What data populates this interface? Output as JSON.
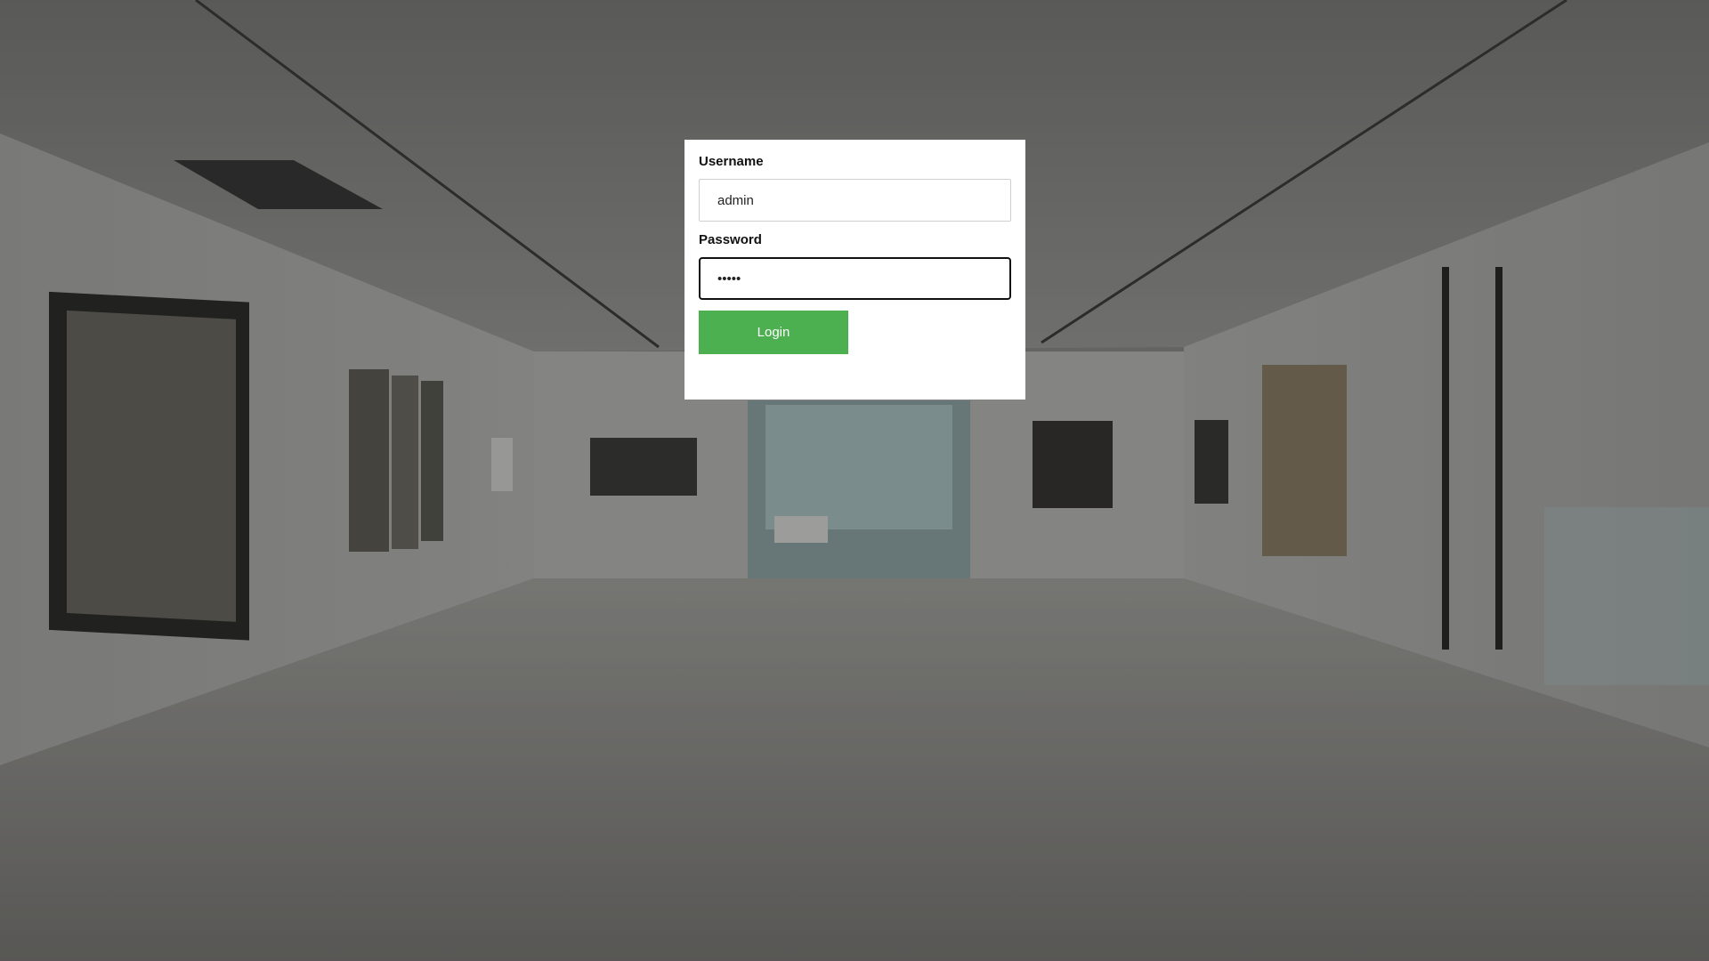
{
  "login": {
    "username_label": "Username",
    "username_value": "admin",
    "password_label": "Password",
    "password_value": "•••••",
    "submit_label": "Login"
  },
  "colors": {
    "button_bg": "#4caf50",
    "card_bg": "#ffffff",
    "focused_border": "#111111"
  }
}
